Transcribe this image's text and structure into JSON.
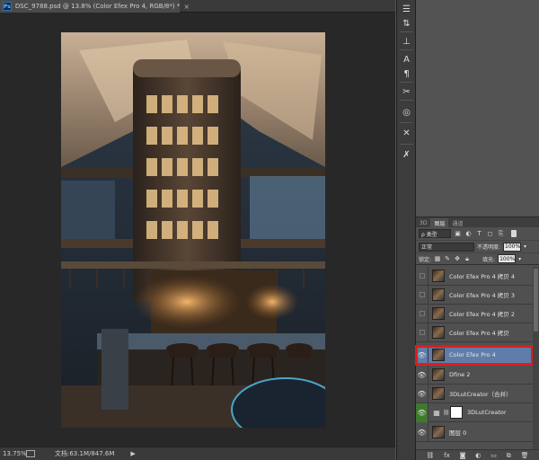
{
  "document": {
    "title": "DSC_9788.psd @ 13.8% (Color Efex Pro 4, RGB/8*) *",
    "app_icon": "Ps",
    "close_glyph": "×"
  },
  "status_bar": {
    "zoom": "13.75%",
    "doc_size": "文档:63.1M/847.6M",
    "arrow": "▶"
  },
  "layers_panel": {
    "tabs": [
      "3D",
      "图层",
      "通道"
    ],
    "active_tab": "图层",
    "filter_kind": "ρ 类型",
    "blend_mode": "正常",
    "opacity_label": "不透明度:",
    "opacity_value": "100%",
    "lock_label": "锁定:",
    "fill_label": "填充:",
    "fill_value": "100%",
    "layers": [
      {
        "name": "Color Efex Pro 4 拷贝 4",
        "visible": false,
        "selected": false,
        "type": "pixel"
      },
      {
        "name": "Color Efex Pro 4 拷贝 3",
        "visible": false,
        "selected": false,
        "type": "pixel"
      },
      {
        "name": "Color Efex Pro 4 拷贝 2",
        "visible": false,
        "selected": false,
        "type": "pixel"
      },
      {
        "name": "Color Efex Pro 4 拷贝",
        "visible": false,
        "selected": false,
        "type": "pixel"
      },
      {
        "name": "Color Efex Pro 4",
        "visible": true,
        "selected": true,
        "type": "pixel"
      },
      {
        "name": "Dfine 2",
        "visible": true,
        "selected": false,
        "type": "pixel"
      },
      {
        "name": "3DLutCreator（合并）",
        "visible": true,
        "selected": false,
        "type": "pixel"
      },
      {
        "name": "3DLutCreator",
        "visible": true,
        "selected": false,
        "type": "adjustment"
      },
      {
        "name": "图层 0",
        "visible": true,
        "selected": false,
        "type": "pixel"
      }
    ]
  },
  "colors": {
    "selection": "#5e7da8",
    "highlight_box": "#e01c1c",
    "canvas_bg": "#282828",
    "panel_bg": "#535353"
  }
}
